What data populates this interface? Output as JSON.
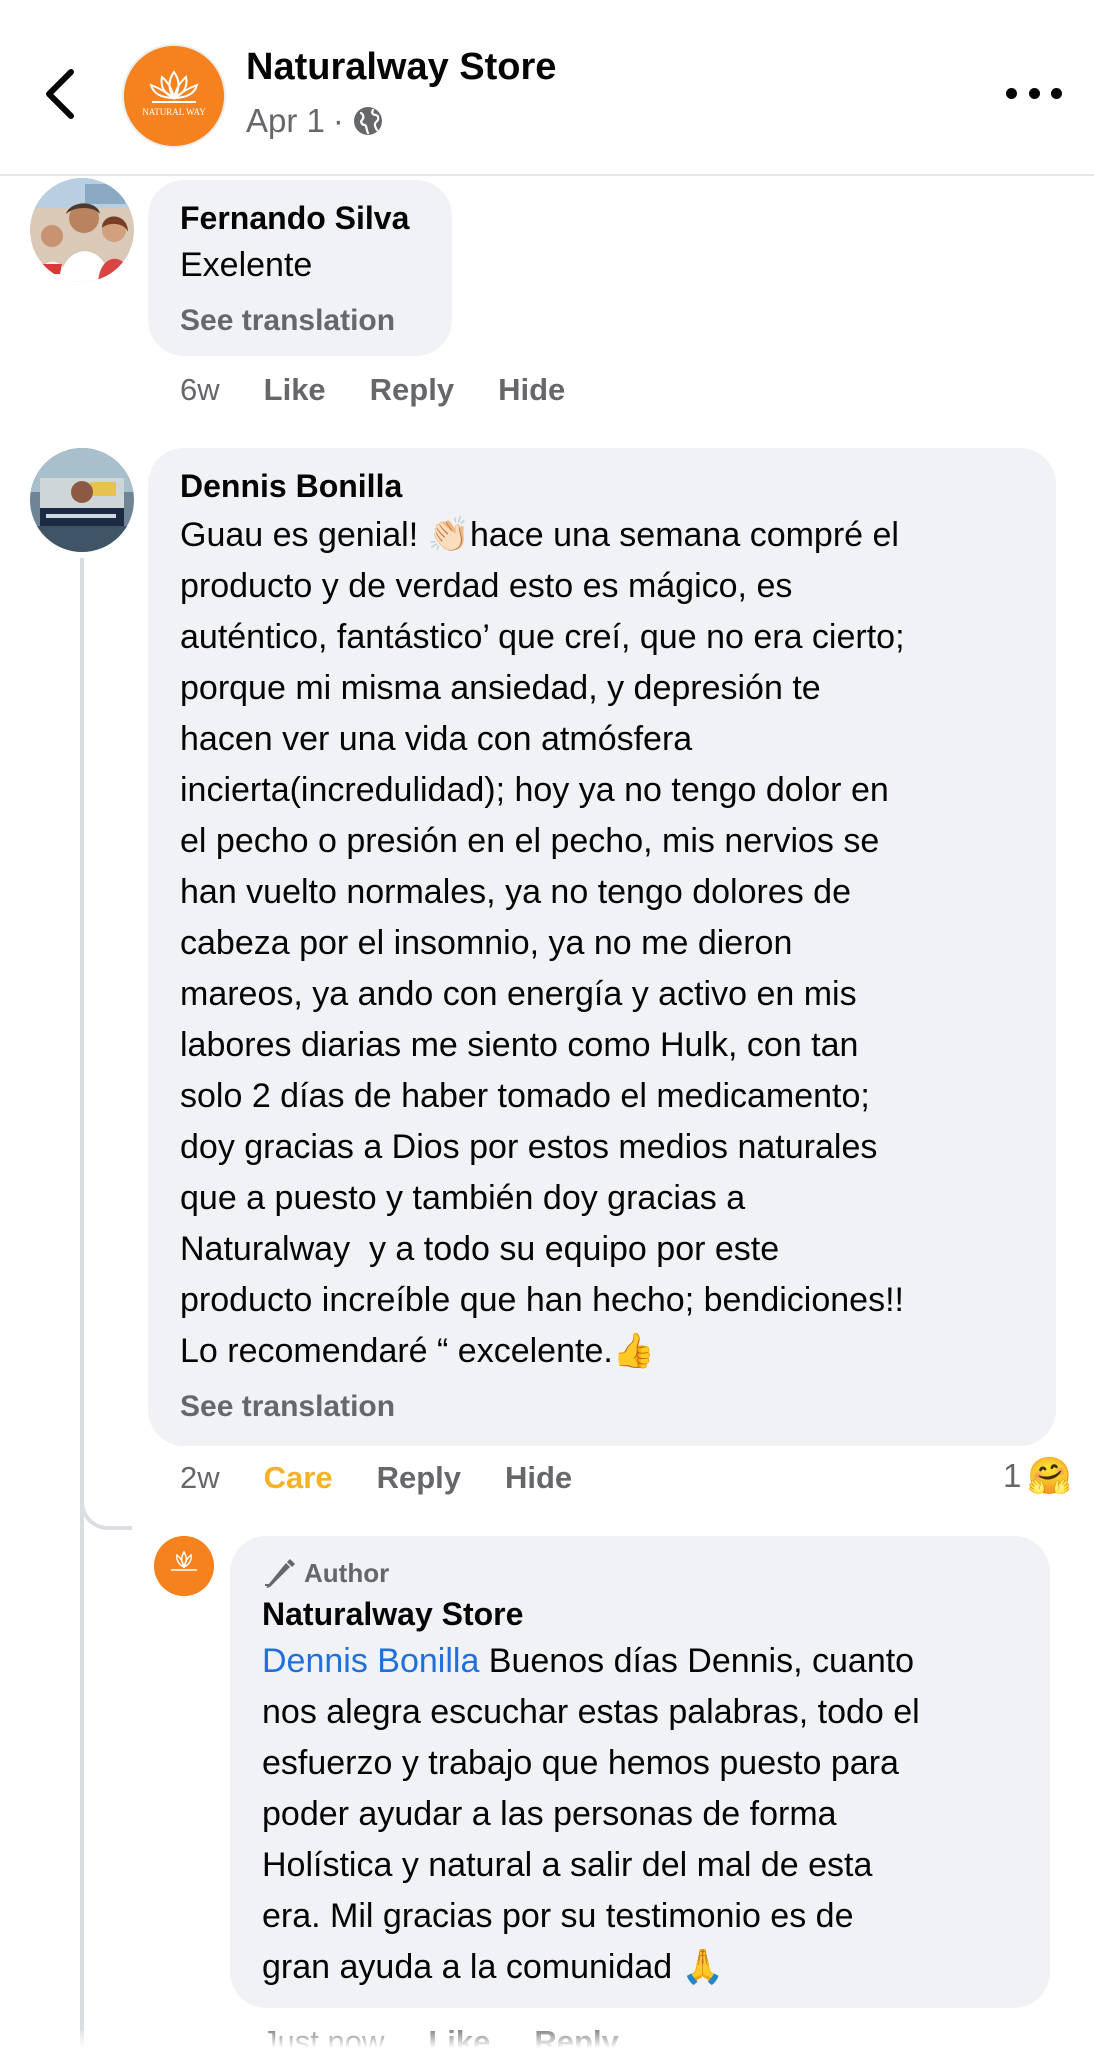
{
  "header": {
    "page_name": "Naturalway Store",
    "post_date": "Apr 1",
    "separator": "·",
    "logo_text": "NATURAL WAY"
  },
  "comments": [
    {
      "author": "Fernando Silva",
      "text": "Exelente",
      "see_translation": "See translation",
      "time": "6w",
      "like_label": "Like",
      "reply_label": "Reply",
      "hide_label": "Hide"
    },
    {
      "author": "Dennis Bonilla",
      "text_lines": [
        "Guau es genial! 👏🏻hace una semana compré el",
        "producto y de verdad esto es mágico, es",
        "auténtico, fantástico’ que creí, que no era cierto;",
        "porque mi misma ansiedad, y depresión te",
        "hacen ver una vida con atmósfera",
        "incierta(incredulidad); hoy ya no tengo dolor en",
        "el pecho o presión en el pecho, mis nervios se",
        "han vuelto normales, ya no tengo dolores de",
        "cabeza por el insomnio, ya no me dieron",
        "mareos, ya ando con energía y activo en mis",
        "labores diarias me siento como Hulk, con tan",
        "solo 2 días de haber tomado el medicamento;",
        "doy gracias a Dios por estos medios naturales",
        "que a puesto y también doy gracias a",
        "Naturalway  y a todo su equipo por este",
        "producto increíble que han hecho; bendiciones!!",
        "Lo recomendaré “ excelente.👍"
      ],
      "see_translation": "See translation",
      "time": "2w",
      "care_label": "Care",
      "reply_label": "Reply",
      "hide_label": "Hide",
      "reaction_count": "1",
      "reaction_emoji": "🤗"
    }
  ],
  "reply": {
    "badge": "Author",
    "author": "Naturalway Store",
    "mention": "Dennis Bonilla",
    "first_line_rest": " Buenos días Dennis, cuanto",
    "text_lines": [
      "nos alegra escuchar estas palabras, todo el",
      "esfuerzo y trabajo que hemos puesto para",
      "poder ayudar a las personas de forma",
      "Holística y natural a salir del mal de esta",
      "era. Mil gracias por su testimonio es de",
      "gran ayuda a la comunidad 🙏"
    ],
    "time": "Just now",
    "like_label": "Like",
    "reply_label": "Reply"
  },
  "colors": {
    "bubble": "#f0f2f5",
    "secondary_text": "#65676b",
    "care": "#f7b125",
    "mention": "#216fdb",
    "brand_orange": "#f5821f"
  },
  "icons": {
    "back": "chevron-left-icon",
    "globe": "globe-icon",
    "more": "more-dots-icon",
    "pencil": "pencil-icon",
    "care_reaction": "care-reaction-icon"
  }
}
